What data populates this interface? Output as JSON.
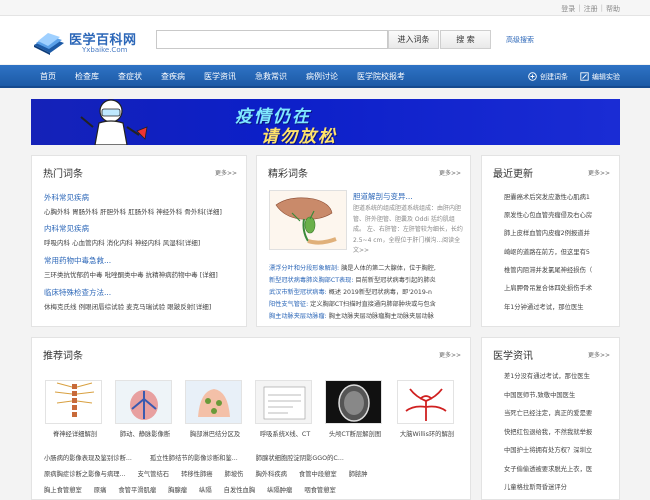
{
  "top_links": [
    "登录",
    "注册",
    "帮助"
  ],
  "top_sep": "|",
  "logo": {
    "cn": "医学百科网",
    "en": "Yxbaike.Com"
  },
  "search": {
    "value": "",
    "placeholder": "",
    "entry_btn": "进入词条",
    "search_btn": "搜 索",
    "advanced": "高级搜索"
  },
  "nav": {
    "items": [
      "首页",
      "检查库",
      "查症状",
      "查疾病",
      "医学资讯",
      "急救常识",
      "病例讨论",
      "医学院校报考"
    ],
    "create": "创建词条",
    "edit": "编辑实验"
  },
  "banner": {
    "line1": "疫情仍在",
    "line2": "请勿放松"
  },
  "hot": {
    "title": "热门词条",
    "more": "更多>>",
    "cats": [
      {
        "name": "外科常见疾病",
        "items": "心胸外科 胃肠外科 肝胆外科 肛肠外科 神经外科 骨外科[详细]"
      },
      {
        "name": "内科常见疾病",
        "items": "呼吸内科 心血管内科 消化内科 神经内科 风湿科[详细]"
      },
      {
        "name": "常用药物中毒急救...",
        "items": "三环类抗忧郁药中毒 吡唑酮类中毒 抗精神病药物中毒 [详细]"
      },
      {
        "name": "临床特殊检查方法...",
        "items": "休梅克氏线 例眼闭唇综试验 麦克马瑞试验 眼跛反射[详细]"
      }
    ]
  },
  "featured": {
    "title": "精彩词条",
    "more": "更多>>",
    "main_title": "胆道解剖与变异...",
    "main_desc": "胆道系统的组成胆道系统组成：由肝内胆管、肝外胆管、胆囊及 Oddi 括约肌组成。 左、右肝管：左肝管较为细长，长约 2.5~4 cm，全程位于肝门横沟...阅读全文>>",
    "lines": [
      {
        "term": "漂浮分叶和分段形象解剖:",
        "text": " 胰是人体的第二大腺体，位于胸腔,"
      },
      {
        "term": "新型冠状病毒肺炎胸部CT表现:",
        "text": " 目前新型冠状病毒引起的肺炎"
      },
      {
        "term": "武汉市新型冠状病毒:",
        "text": " 概述 2019新型冠状病毒，即'2019-n"
      },
      {
        "term": "阳性支气管征:",
        "text": " 定义胸部CT扫描时直接通向肺部肿块或与包含"
      },
      {
        "term": "胸主动脉夹层动脉瘤:",
        "text": " 胸主动脉夹层动脉瘤胸主动脉夹层动脉"
      }
    ]
  },
  "recent": {
    "title": "最近更新",
    "more": "更多>>",
    "items": [
      "胆囊癌术后突发应激性心肌病1",
      "原发性心包血管壳瘤侵及右心房",
      "肺上皮样血管内皮瘤2例报道并",
      "崎岖的道路在前方，但这里有5",
      "椎管内阻滞并发氯尾神经损伤（",
      "上肩胛骨吊复合体四处损伤手术",
      "年1分钟通过考试，那位医生"
    ]
  },
  "recommend": {
    "title": "推荐词条",
    "more": "更多>>",
    "items": [
      "脊神经详细解剖",
      "肺动、静脉影像断",
      "胸部淋巴结分区及",
      "呼吸系统X线、CT",
      "头颅CT断层解剖图",
      "大脑Willis环的解剖"
    ],
    "tags": [
      [
        "小肠病的影像表现及鉴别诊断...",
        "孤立性肺结节的影像诊断和鉴...",
        "肺腺状细胞腔淀阴影GGO的C..."
      ],
      [
        "原病胸症诊断之影像与病理...",
        "支气管结石",
        "转移性肺癌",
        "肺坡伤",
        "胸外科疾病",
        "食管中段憩室",
        "肺脓肿"
      ],
      [
        "胸上食管憩室",
        "原痛",
        "食管平滑肌瘤",
        "胸腺瘤",
        "纵隔",
        "自发性血胸",
        "纵隔肿瘤",
        "咽食管憩室"
      ]
    ]
  },
  "news": {
    "title": "医学资讯",
    "more": "更多>>",
    "items": [
      "差1分没有通过考试，那位医生",
      "中国医师节,致敬中国医生",
      "当死亡已经注定，真正的爱是要",
      "快把红包退给我，不然我就举报",
      "中国护士将拥有处方权？深圳立",
      "女子偷偷透被要求脱光上衣，医",
      "儿童格拉斯哥昏迷评分"
    ]
  },
  "colors": {
    "nav": "#1f5fae",
    "link": "#2c67b8",
    "banner": "#1522b8"
  },
  "icons": [
    "book-logo-icon",
    "create-entry-icon",
    "edit-icon",
    "doctor-mascot-icon"
  ]
}
